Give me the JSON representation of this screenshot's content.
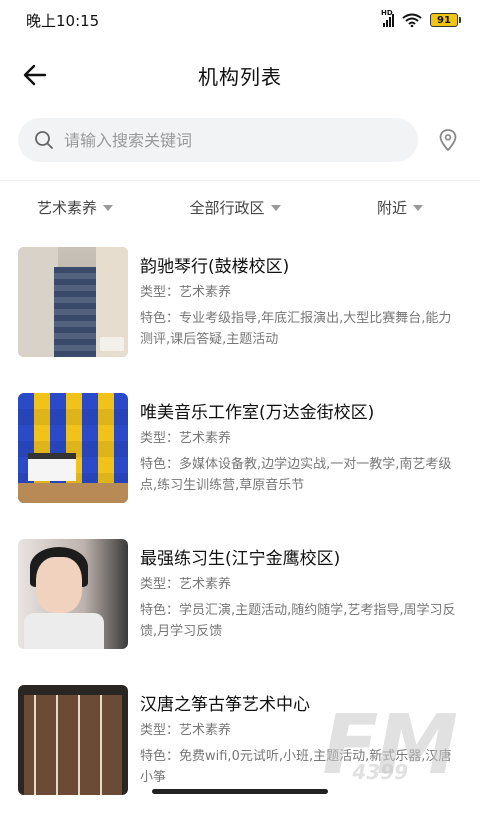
{
  "status_bar": {
    "time": "晚上10:15",
    "signal_label": "HD",
    "battery": "91"
  },
  "nav": {
    "title": "机构列表"
  },
  "search": {
    "placeholder": "请输入搜索关键词"
  },
  "filters": [
    {
      "label": "艺术素养"
    },
    {
      "label": "全部行政区"
    },
    {
      "label": "附近"
    }
  ],
  "institutions": [
    {
      "name": "韵驰琴行(鼓楼校区)",
      "type": "类型：艺术素养",
      "features": "特色：专业考级指导,年底汇报演出,大型比赛舞台,能力测评,课后答疑,主题活动"
    },
    {
      "name": "唯美音乐工作室(万达金街校区)",
      "type": "类型：艺术素养",
      "features": "特色：多媒体设备教,边学边实战,一对一教学,南艺考级点,练习生训练营,草原音乐节"
    },
    {
      "name": "最强练习生(江宁金鹰校区)",
      "type": "类型：艺术素养",
      "features": "特色：学员汇演,主题活动,随约随学,艺考指导,周学习反馈,月学习反馈"
    },
    {
      "name": "汉唐之筝古筝艺术中心",
      "type": "类型：艺术素养",
      "features": "特色：免费wifi,0元试听,小班,主题活动,新式乐器,汉唐小筝"
    }
  ],
  "watermark": {
    "big": "FM",
    "small": "4399"
  },
  "colors": {
    "search_bg": "#f2f3f5",
    "text_primary": "#111111",
    "text_secondary": "#777777",
    "battery": "#f1c40f"
  }
}
